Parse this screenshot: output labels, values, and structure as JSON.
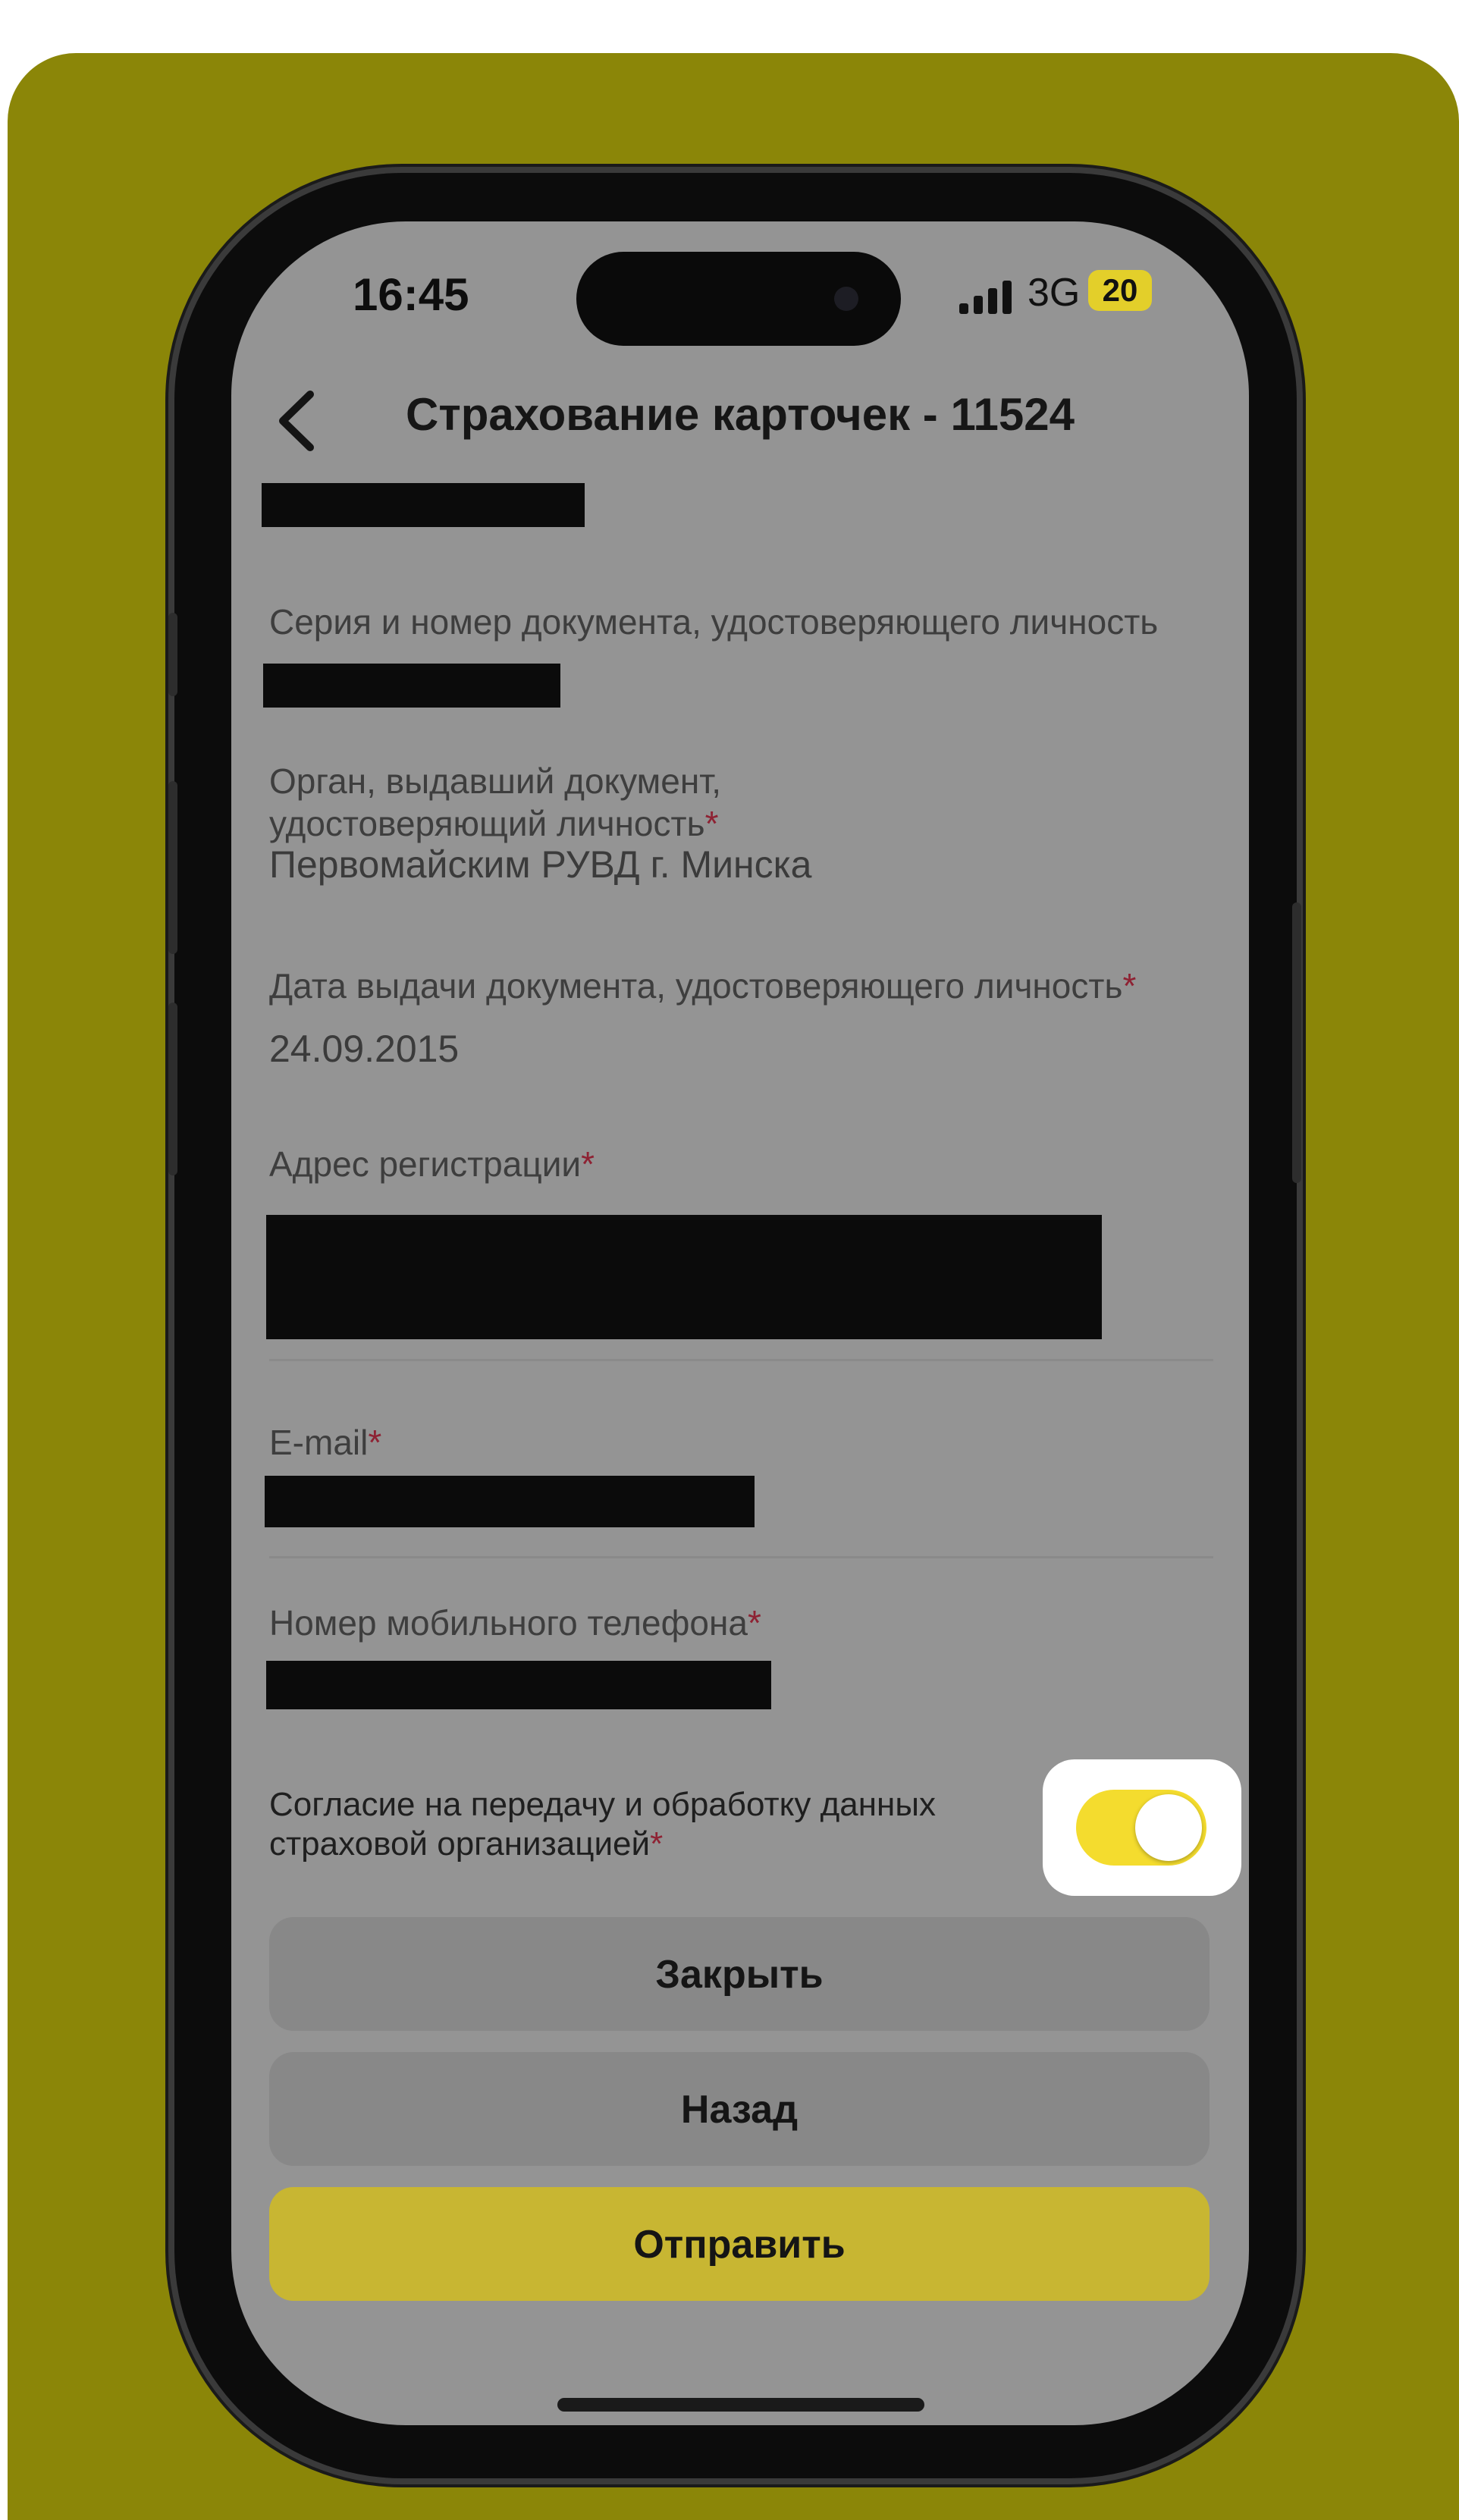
{
  "status_bar": {
    "time": "16:45",
    "network": "3G",
    "battery": "20"
  },
  "nav": {
    "back_icon": "chevron-left-icon",
    "title": "Страхование карточек - 11524"
  },
  "fields": {
    "document_number_label": "Серия и номер документа, удостоверяющего личность",
    "issuer_label": "Орган, выдавший документ, удостоверяющий личность",
    "issuer_value": "Первомайским РУВД г. Минска",
    "issue_date_label": "Дата выдачи документа, удостоверяющего личность",
    "issue_date_value": "24.09.2015",
    "address_label": "Адрес регистрации",
    "email_label": "E-mail",
    "phone_label": "Номер мобильного телефона",
    "required_mark": "*"
  },
  "consent": {
    "label": "Согласие на передачу и обработку данных страховой организацией",
    "enabled": true
  },
  "buttons": {
    "close": "Закрыть",
    "back": "Назад",
    "submit": "Отправить"
  },
  "colors": {
    "background": "#8b8608",
    "accent_yellow": "#f4dc2e",
    "required": "#8e2233"
  }
}
